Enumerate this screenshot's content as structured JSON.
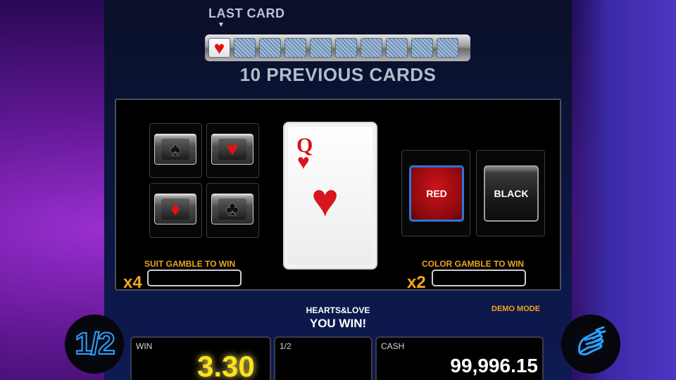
{
  "header": {
    "last_card_label": "LAST CARD",
    "arrow_glyph": "▼",
    "previous_cards_label": "10 PREVIOUS CARDS",
    "history": {
      "revealed_suit_glyph": "♥",
      "slots": 10
    }
  },
  "board": {
    "suit_buttons": [
      {
        "name": "spade",
        "glyph": "♠",
        "color": "#111111"
      },
      {
        "name": "heart",
        "glyph": "♥",
        "color": "#e11414"
      },
      {
        "name": "diamond",
        "glyph": "♦",
        "color": "#e11414"
      },
      {
        "name": "club",
        "glyph": "♣",
        "color": "#111111"
      }
    ],
    "current_card": {
      "rank": "Q",
      "suit_glyph": "♥",
      "color": "#d8141e"
    },
    "color_buttons": {
      "red_label": "RED",
      "black_label": "BLACK"
    },
    "suit_gamble_label": "SUIT GAMBLE TO WIN",
    "suit_gamble_multiplier": "x4",
    "color_gamble_label": "COLOR GAMBLE TO WIN",
    "color_gamble_multiplier": "x2"
  },
  "status": {
    "game_name": "HEARTS&LOVE",
    "result": "YOU WIN!",
    "demo_mode": "DEMO MODE"
  },
  "controls": {
    "half_button_label": "1/2"
  },
  "footer": {
    "win_label": "WIN",
    "win_value": "3.30",
    "half_label": "1/2",
    "cash_label": "CASH",
    "cash_value": "99,996.15"
  },
  "colors": {
    "accent_orange": "#f0a51d",
    "win_yellow": "#ffe11c",
    "selection_blue": "#2f75d8"
  }
}
